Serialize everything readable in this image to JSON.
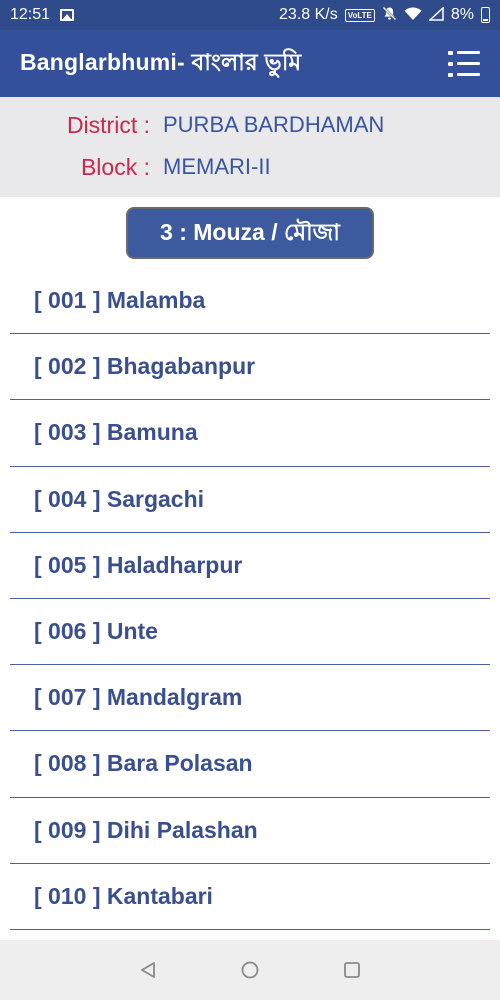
{
  "status_bar": {
    "time": "12:51",
    "net_speed": "23.8 K/s",
    "volte": "VoLTE",
    "battery": "8%"
  },
  "app_bar": {
    "title": "Banglarbhumi- বাংলার ভুমি",
    "menu_icon": "menu-list-icon"
  },
  "location": {
    "district_label": "District :",
    "district_value": "PURBA BARDHAMAN",
    "block_label": "Block :",
    "block_value": "MEMARI-II"
  },
  "step_button": {
    "label": "3 : Mouza / মৌজা"
  },
  "mouza_list": [
    "[ 001 ] Malamba",
    "[ 002 ] Bhagabanpur",
    "[ 003 ] Bamuna",
    "[ 004 ] Sargachi",
    "[ 005 ] Haladharpur",
    "[ 006 ] Unte",
    "[ 007 ] Mandalgram",
    "[ 008 ] Bara Polasan",
    "[ 009 ] Dihi Palashan",
    "[ 010 ] Kantabari"
  ],
  "nav_bar": {
    "back_icon": "back-triangle-icon",
    "home_icon": "home-circle-icon",
    "recents_icon": "recents-square-icon"
  },
  "colors": {
    "app_bar": "#34509a",
    "status_bar": "#2f4b8b",
    "label_red": "#c8294e",
    "value_blue": "#3a55a0",
    "list_text": "#3a4f8e"
  }
}
